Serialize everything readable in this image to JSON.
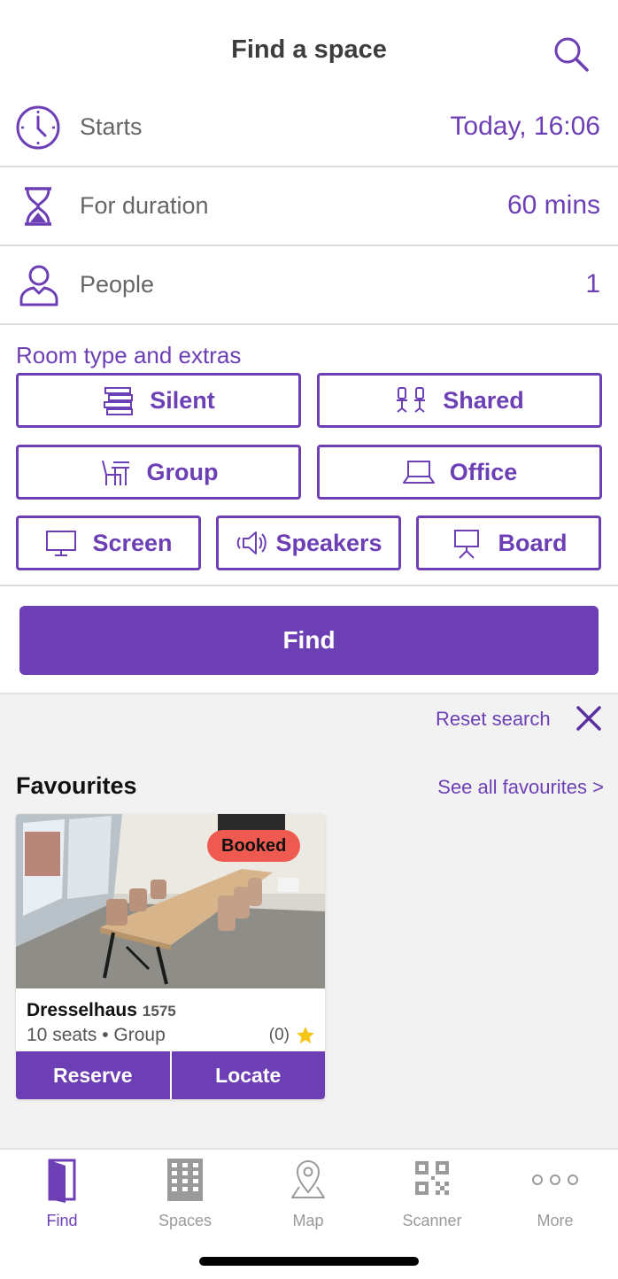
{
  "header": {
    "title": "Find a space"
  },
  "rows": {
    "starts": {
      "label": "Starts",
      "value": "Today, 16:06"
    },
    "duration": {
      "label": "For duration",
      "value": "60 mins"
    },
    "people": {
      "label": "People",
      "value": "1"
    }
  },
  "extras": {
    "title": "Room type and extras",
    "silent": "Silent",
    "shared": "Shared",
    "group": "Group",
    "office": "Office",
    "screen": "Screen",
    "speakers": "Speakers",
    "board": "Board"
  },
  "find_button": "Find",
  "reset_search": "Reset search",
  "favourites": {
    "title": "Favourites",
    "see_all": "See all favourites >",
    "card": {
      "badge": "Booked",
      "name": "Dresselhaus",
      "number": "1575",
      "meta": "10 seats • Group",
      "rating": "(0)",
      "reserve": "Reserve",
      "locate": "Locate"
    }
  },
  "tabs": {
    "find": "Find",
    "spaces": "Spaces",
    "map": "Map",
    "scanner": "Scanner",
    "more": "More"
  },
  "colors": {
    "accent": "#6d3fb5",
    "badge": "#ef5a50",
    "star": "#f5c518",
    "inactive": "#9a9a9a"
  },
  "icons": [
    "search-icon",
    "clock-icon",
    "hourglass-icon",
    "person-icon",
    "books-icon",
    "chairs-icon",
    "desk-chair-icon",
    "laptop-icon",
    "monitor-icon",
    "speaker-icon",
    "presentation-board-icon",
    "close-icon",
    "star-icon",
    "door-icon",
    "building-icon",
    "map-pin-icon",
    "qr-code-icon",
    "more-dots-icon"
  ]
}
